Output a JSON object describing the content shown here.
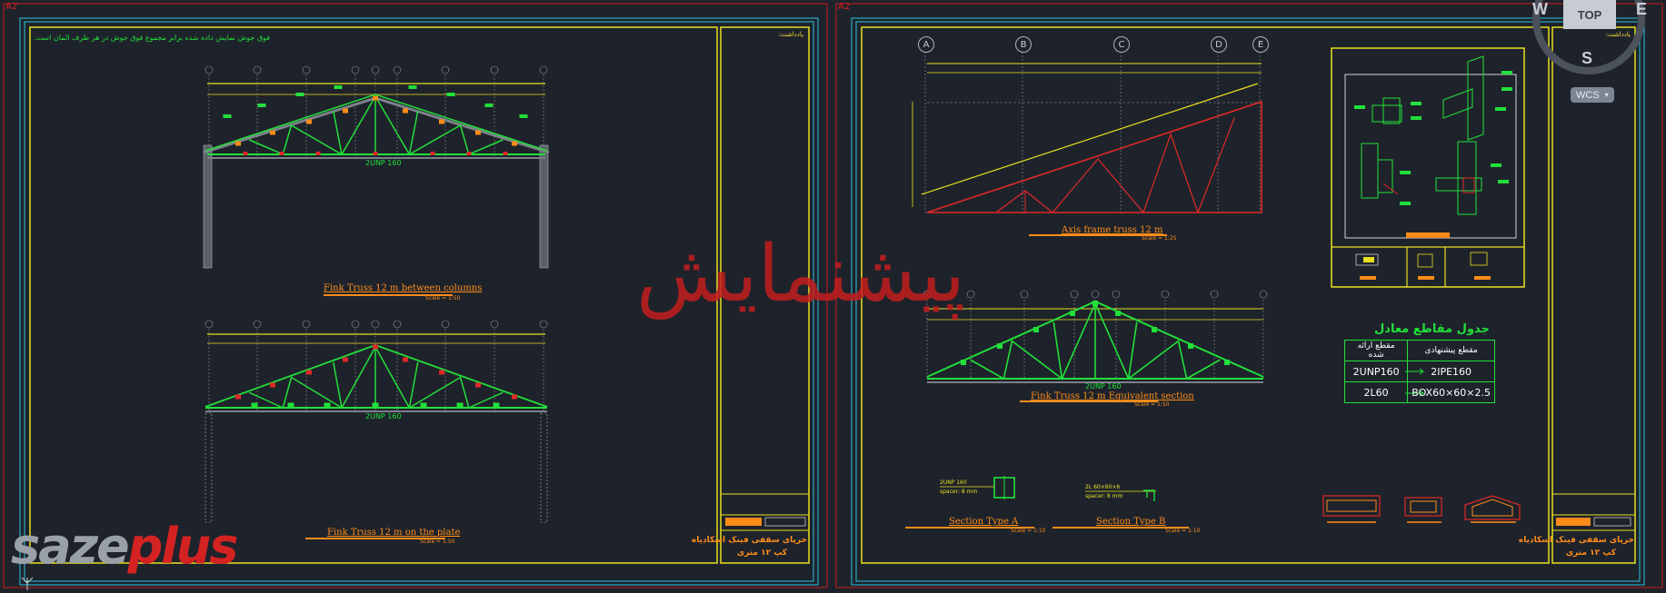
{
  "layout_tabs": {
    "left": "A2",
    "right": "A2"
  },
  "viewcube": {
    "west": "W",
    "top": "TOP",
    "east": "E",
    "south": "S",
    "wcs": "WCS"
  },
  "sheet_left": {
    "note": "فوق جوش نمایش داده شده برابر مجموع فوق جوش در هر طرف المان است.",
    "section_label_1": "2UNP 160",
    "section_label_2": "2UNP 160",
    "drawing_1_title": "Fink Truss 12 m between columns",
    "drawing_1_scale": "Scale = 1:50",
    "drawing_2_title": "Fink Truss 12 m on the plate",
    "drawing_2_scale": "Scale = 1:50",
    "titleblock_header": "یادداشت:",
    "titleblock_title": "خرپای سقفی فینک اسکادیاه",
    "titleblock_subtitle": "کپ ۱۲ متری"
  },
  "sheet_right": {
    "axes": [
      "A",
      "B",
      "C",
      "D",
      "E"
    ],
    "axis_frame_title": "Axis frame truss 12 m",
    "axis_frame_scale": "Scale = 1:25",
    "equivalent_title": "Fink Truss 12 m Equivalent section",
    "equivalent_scale": "Scale = 1:50",
    "equivalent_section": "2UNP 160",
    "section_a_title": "Section Type A",
    "section_a_scale": "Scale = 1:10",
    "section_b_title": "Section Type B",
    "section_b_scale": "Scale = 1:10",
    "section_a_note_1": "2UNP 160",
    "section_a_note_2": "spacer: 8 mm",
    "section_b_note_1": "2L 60×60×6",
    "section_b_note_2": "spacer: 8 mm",
    "table_title": "جدول مقاطع معادل",
    "table_headers": [
      "مقطع ارائه شده",
      "مقطع پیشنهادی"
    ],
    "table_rows": [
      [
        "2UNP160",
        "2IPE160"
      ],
      [
        "2L60",
        "BOX60×60×2.5"
      ]
    ],
    "titleblock_header": "یادداشت:",
    "titleblock_title": "خرپای سقفی فینک اسکادیاه",
    "titleblock_subtitle": "کپ ۱۲ متری"
  },
  "watermark": "پیشنمایش",
  "logo": {
    "part1": "saze",
    "part2": "plus"
  },
  "colors": {
    "background": "#1e232b",
    "sheet_border_red": "#c81e1e",
    "sheet_border_cyan": "#29c4e0",
    "frame_yellow": "#e8e020",
    "truss_green": "#22e03a",
    "truss_red": "#e02828",
    "label_orange": "#ff8c1a"
  }
}
